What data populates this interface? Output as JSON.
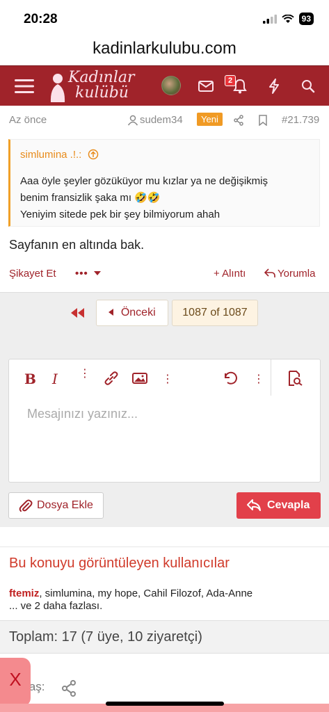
{
  "status": {
    "time": "20:28",
    "battery": "93"
  },
  "browser": {
    "url": "kadinlarkulubu.com"
  },
  "header": {
    "logo_text_1": "Kadınlar",
    "logo_text_2": "kulübü",
    "notification_count": "2"
  },
  "post": {
    "time": "Az önce",
    "author": "sudem34",
    "badge": "Yeni",
    "number": "#21.739",
    "quote_author": "simlumina .!.:",
    "quote_line1": "Aaa öyle şeyler gözüküyor mu kızlar ya ne değişikmiş",
    "quote_line2": "benim fransizlik şaka mı 🤣🤣",
    "quote_line3": "Yeniyim sitede pek bir şey bilmiyorum ahah",
    "text": "Sayfanın en altında bak.",
    "report": "Şikayet Et",
    "more": "•••",
    "quote_action": "+ Alıntı",
    "reply_action": "Yorumla"
  },
  "pagination": {
    "prev": "Önceki",
    "current": "1087 of 1087"
  },
  "editor": {
    "placeholder": "Mesajınızı yazınız...",
    "attach": "Dosya Ekle",
    "reply": "Cevapla"
  },
  "viewers": {
    "title": "Bu konuyu görüntüleyen kullanıcılar",
    "first": "ftemiz",
    "rest": ", simlumina, my hope, Cahil Filozof, Ada-Anne",
    "more": "... ve 2 daha fazlası."
  },
  "total": "Toplam: 17 (7 üye, 10 ziyaretçi)",
  "share": {
    "label": "laş:",
    "close": "X"
  }
}
